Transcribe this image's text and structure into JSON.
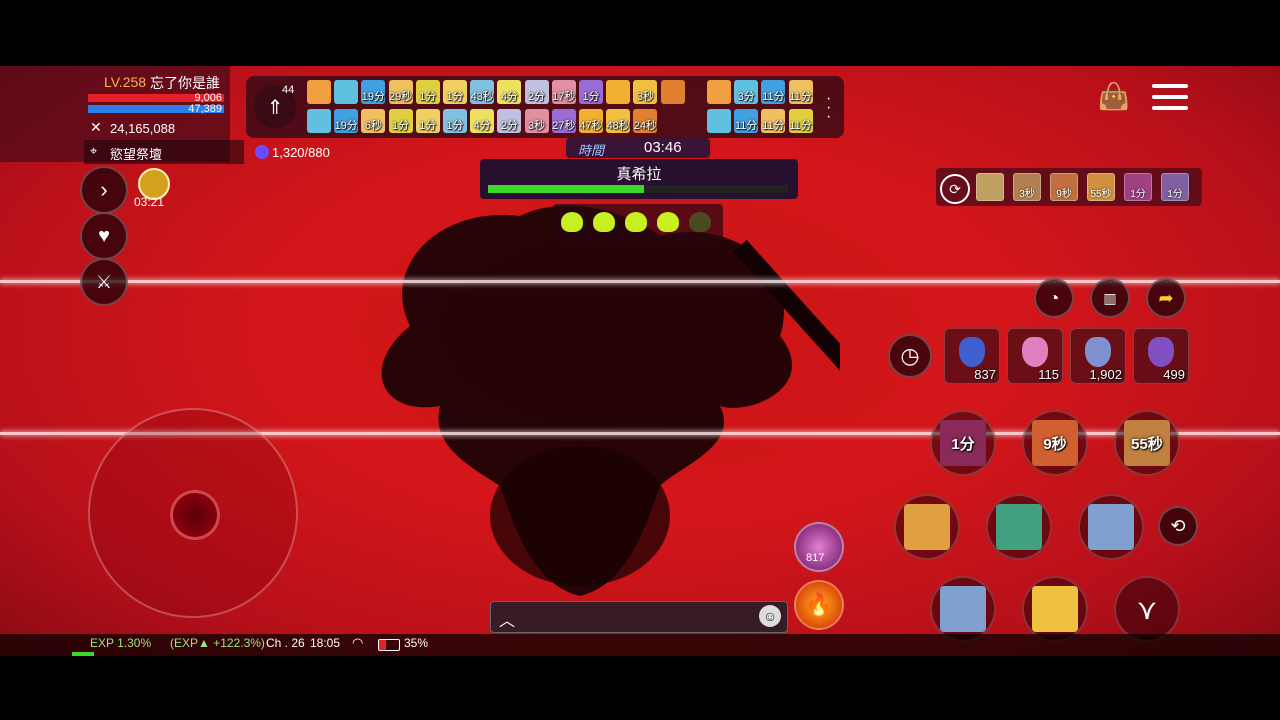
{
  "player": {
    "level": "LV.258",
    "name": "忘了你是誰",
    "hp": "9,006",
    "mp": "47,389",
    "combat_power": "24,165,088",
    "location": "慾望祭壇",
    "currency": "1,320/880"
  },
  "level_up_badge": "44",
  "buffs_row1": [
    "",
    "",
    "19分",
    "29秒",
    "1分",
    "1分",
    "43秒",
    "4分",
    "2分",
    "17秒",
    "1分",
    "",
    "3秒",
    ""
  ],
  "buffs_row2": [
    "",
    "19分",
    "6秒",
    "1分",
    "1分",
    "1分",
    "4分",
    "2分",
    "3秒",
    "27秒",
    "47秒",
    "48秒",
    "24秒"
  ],
  "buffs_right_row1": [
    "",
    "3分",
    "11分",
    "11分"
  ],
  "buffs_right_row2": [
    "",
    "11分",
    "11分",
    "11分"
  ],
  "boss": {
    "timer_label": "時間",
    "timer_value": "03:46",
    "name": "真希拉",
    "hp_fraction": 0.52,
    "skulls_active": 4,
    "skulls_total": 5
  },
  "event_timer": "03:21",
  "right_status_icons": [
    "",
    "3秒",
    "9秒",
    "55秒",
    "1分",
    "1分"
  ],
  "potions": [
    {
      "name": "potion-red-blue",
      "count": "837"
    },
    {
      "name": "potion-pink",
      "count": "115"
    },
    {
      "name": "potion-purple",
      "count": "1,902"
    },
    {
      "name": "potion-elixir",
      "count": "499"
    }
  ],
  "skills_row1": [
    "1分",
    "9秒",
    "55秒"
  ],
  "skills_row2": [
    "",
    "",
    ""
  ],
  "skills_row3": [
    "",
    ""
  ],
  "quick_slot_count": "817",
  "status_bar": {
    "exp": "EXP  1.30%",
    "exp_bonus": "(EXP▲ +122.3%)",
    "channel": "Ch . 26",
    "time": "18:05",
    "battery": "35%"
  },
  "colors": {
    "scene_red": "#d4161a",
    "boss_hp": "#3bd82a",
    "level_text": "#ffb347",
    "hp_bar": "#e8202a",
    "mp_bar": "#2a7fe8"
  }
}
